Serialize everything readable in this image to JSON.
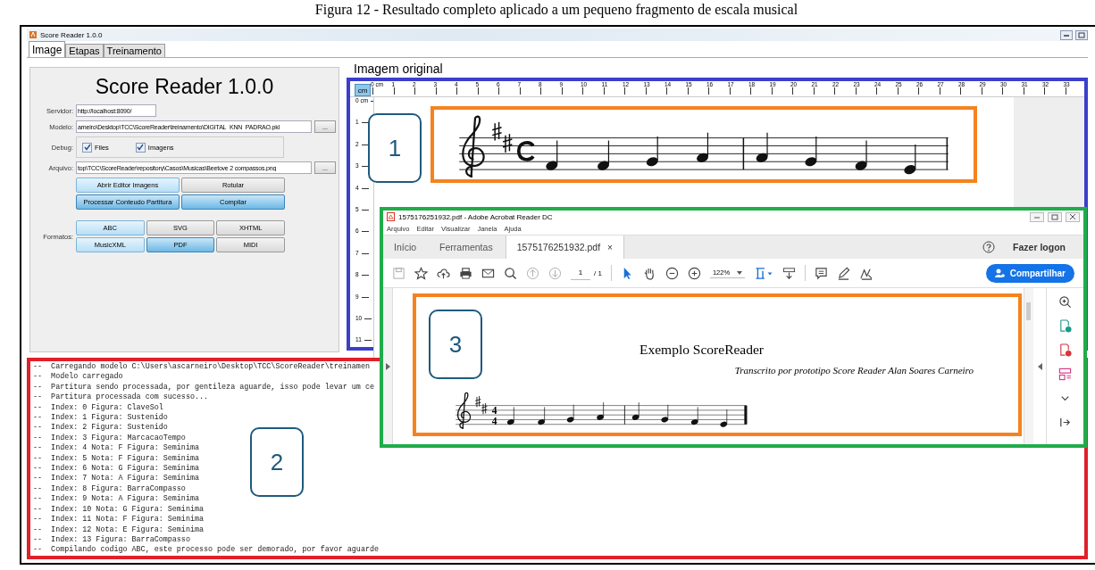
{
  "caption": "Figura 12 - Resultado completo aplicado a um pequeno fragmento de escala musical",
  "window": {
    "title": "Score Reader 1.0.0"
  },
  "tabs": [
    {
      "label": "Image",
      "selected": true
    },
    {
      "label": "Etapas",
      "selected": false
    },
    {
      "label": "Treinamento",
      "selected": false
    }
  ],
  "form": {
    "heading": "Score Reader 1.0.0",
    "servidor": {
      "label": "Servidor:",
      "value": "http://localhost:8090/"
    },
    "modelo": {
      "label": "Modelo:",
      "value": "arneiro\\Desktop\\TCC\\ScoreReader\\treinamento\\DIGITAL_KNN_PADRAO.pkl",
      "browse": "..."
    },
    "debug": {
      "label": "Debug:",
      "options": [
        {
          "label": "Files",
          "checked": true
        },
        {
          "label": "Imagens",
          "checked": true
        }
      ]
    },
    "arquivo": {
      "label": "Arquivo:",
      "value": "top\\TCC\\ScoreReader\\repository\\Casos\\Musicas\\Beetove 2 compassos.png",
      "browse": "..."
    },
    "actions": [
      {
        "label": "Abrir Editor Imagens",
        "kind": "light"
      },
      {
        "label": "Rotular",
        "kind": "plain"
      },
      {
        "label": "Processar Conteudo Partitura",
        "kind": "dark"
      },
      {
        "label": "Compilar",
        "kind": "dark"
      }
    ],
    "formats": {
      "label": "Formatos:",
      "buttons": [
        {
          "label": "ABC",
          "kind": "light"
        },
        {
          "label": "SVG",
          "kind": "plain"
        },
        {
          "label": "XHTML",
          "kind": "plain"
        },
        {
          "label": "MusicXML",
          "kind": "light"
        },
        {
          "label": "PDF",
          "kind": "dark"
        },
        {
          "label": "MIDI",
          "kind": "plain"
        }
      ]
    }
  },
  "image_panel": {
    "label": "Imagem original",
    "unit_button": "cm",
    "callout": "1",
    "top_ruler": [
      "0 cm",
      "1",
      "2",
      "3",
      "4",
      "5",
      "6",
      "7",
      "8",
      "9",
      "10",
      "11",
      "12",
      "13",
      "14",
      "15",
      "16",
      "17",
      "18",
      "19",
      "20",
      "21",
      "22",
      "23",
      "24",
      "25",
      "26",
      "27",
      "28",
      "29",
      "30",
      "31",
      "32",
      "33"
    ],
    "side_ruler": [
      "0 cm",
      "1",
      "2",
      "3",
      "4",
      "5",
      "6",
      "7",
      "8",
      "9",
      "10",
      "11"
    ]
  },
  "log": {
    "callout": "2",
    "lines": [
      "--  Carregando modelo C:\\Users\\ascarneiro\\Desktop\\TCC\\ScoreReader\\treinamen",
      "--  Modelo carregado",
      "--  Partitura sendo processada, por gentileza aguarde, isso pode levar um ce",
      "--  Partitura processada com sucesso...",
      "--  Index: 0 Figura: ClaveSol",
      "--  Index: 1 Figura: Sustenido",
      "--  Index: 2 Figura: Sustenido",
      "--  Index: 3 Figura: MarcacaoTempo",
      "--  Index: 4 Nota: F Figura: Seminima",
      "--  Index: 5 Nota: F Figura: Seminima",
      "--  Index: 6 Nota: G Figura: Seminima",
      "--  Index: 7 Nota: A Figura: Seminima",
      "--  Index: 8 Figura: BarraCompasso",
      "--  Index: 9 Nota: A Figura: Seminima",
      "--  Index: 10 Nota: G Figura: Seminima",
      "--  Index: 11 Nota: F Figura: Seminima",
      "--  Index: 12 Nota: E Figura: Seminima",
      "--  Index: 13 Figura: BarraCompasso",
      "--  Compilando codigo ABC, este processo pode ser demorado, por favor aguarde"
    ]
  },
  "pdf_viewer": {
    "title": "1575176251932.pdf - Adobe Acrobat Reader DC",
    "menu": [
      "Arquivo",
      "Editar",
      "Visualizar",
      "Janela",
      "Ajuda"
    ],
    "tabs": [
      {
        "label": "Início",
        "selected": false
      },
      {
        "label": "Ferramentas",
        "selected": false
      },
      {
        "label": "1575176251932.pdf",
        "selected": true,
        "close": "×"
      }
    ],
    "login": "Fazer logon",
    "page": "1",
    "page_total": "/ 1",
    "zoom": "122%",
    "share": "Compartilhar",
    "document": {
      "title": "Exemplo ScoreReader",
      "subtitle": "Transcrito por prototipo Score Reader Alan Soares Carneiro",
      "time_signature": [
        "4",
        "4"
      ]
    },
    "callout": "3"
  }
}
